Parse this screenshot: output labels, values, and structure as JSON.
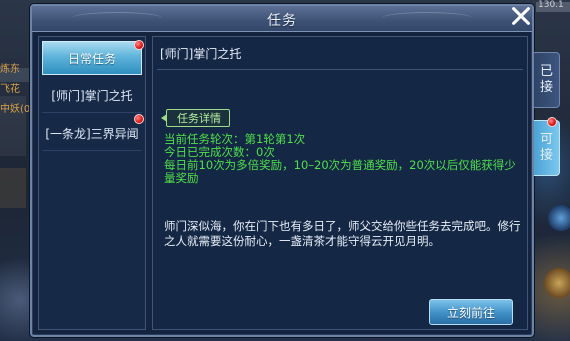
{
  "window": {
    "title": "任务",
    "close_label": "×"
  },
  "quest_list": [
    {
      "label": "日常任务",
      "active": true,
      "has_alert": true
    },
    {
      "label": "[师门]掌门之托",
      "active": false,
      "has_alert": false
    },
    {
      "label": "[一条龙]三界异闻",
      "active": false,
      "has_alert": true
    }
  ],
  "detail": {
    "quest_name": "[师门]掌门之托",
    "section_label": "任务详情",
    "info_lines": [
      "当前任务轮次：第1轮第1次",
      "今日已完成次数：0次",
      "每日前10次为多倍奖励，10–20次为普通奖励，20次以后仅能获得少量奖励"
    ],
    "description": "师门深似海，你在门下也有多日了，师父交给你些任务去完成吧。修行之人就需要这份耐心，一盏清茶才能守得云开见月明。",
    "go_button": "立刻前往"
  },
  "side_tabs": [
    {
      "label": "已接",
      "active": false,
      "has_alert": false
    },
    {
      "label": "可接",
      "active": true,
      "has_alert": true
    }
  ],
  "hud": {
    "left_fragments": [
      "炼东",
      "飞花",
      "",
      "",
      "中妖(0"
    ],
    "top_right": "130.1"
  },
  "colors": {
    "accent": "#5fb4da",
    "info_green": "#4fe04a",
    "alert_red": "#e01e1e"
  }
}
